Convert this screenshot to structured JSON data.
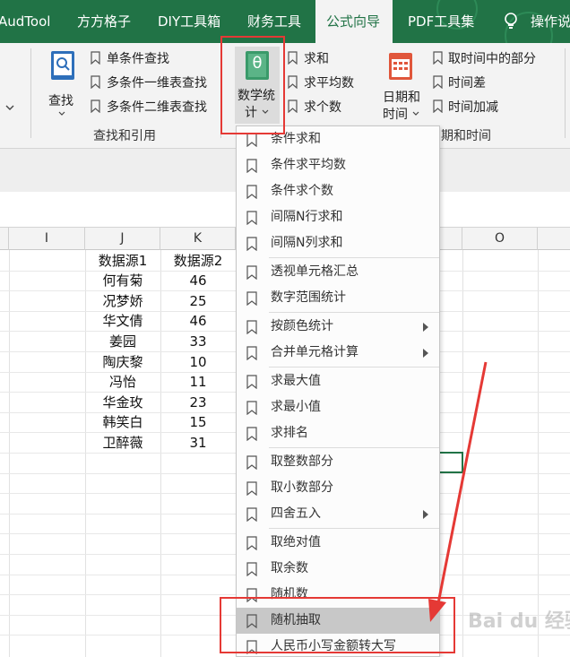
{
  "tabs": [
    {
      "label": "AudTool"
    },
    {
      "label": "方方格子"
    },
    {
      "label": "DIY工具箱"
    },
    {
      "label": "财务工具"
    },
    {
      "label": "公式向导"
    },
    {
      "label": "PDF工具集"
    },
    {
      "label": "操作说"
    }
  ],
  "ribbon": {
    "lookup": {
      "big_button_label": "查找",
      "items": [
        "单条件查找",
        "多条件一维表查找",
        "多条件二维表查找"
      ],
      "group_label": "查找和引用"
    },
    "math": {
      "big_button_line1": "数学统",
      "big_button_line2": "计",
      "big_button_glyph": "θ",
      "items": [
        "求和",
        "求平均数",
        "求个数"
      ]
    },
    "datetime": {
      "big_button_line1": "日期和",
      "big_button_line2": "时间",
      "items": [
        "取时间中的部分",
        "时间差",
        "时间加减"
      ],
      "group_label": "期和时间"
    }
  },
  "columns": [
    "I",
    "J",
    "K",
    "O"
  ],
  "table": {
    "headers": [
      "数据源1",
      "数据源2"
    ],
    "rows": [
      [
        "何有菊",
        "46"
      ],
      [
        "况梦娇",
        "25"
      ],
      [
        "华文倩",
        "46"
      ],
      [
        "姜园",
        "33"
      ],
      [
        "陶庆黎",
        "10"
      ],
      [
        "冯怡",
        "11"
      ],
      [
        "华金玫",
        "23"
      ],
      [
        "韩笑白",
        "15"
      ],
      [
        "卫醉薇",
        "31"
      ]
    ]
  },
  "menu": {
    "items": [
      {
        "label": "条件求和",
        "submenu": false
      },
      {
        "label": "条件求平均数",
        "submenu": false
      },
      {
        "label": "条件求个数",
        "submenu": false
      },
      {
        "label": "间隔N行求和",
        "submenu": false
      },
      {
        "label": "间隔N列求和",
        "submenu": false
      },
      {
        "label": "透视单元格汇总",
        "submenu": false
      },
      {
        "label": "数字范围统计",
        "submenu": false
      },
      {
        "label": "按颜色统计",
        "submenu": true
      },
      {
        "label": "合并单元格计算",
        "submenu": true
      },
      {
        "label": "求最大值",
        "submenu": false
      },
      {
        "label": "求最小值",
        "submenu": false
      },
      {
        "label": "求排名",
        "submenu": false
      },
      {
        "label": "取整数部分",
        "submenu": false
      },
      {
        "label": "取小数部分",
        "submenu": false
      },
      {
        "label": "四舍五入",
        "submenu": true
      },
      {
        "label": "取绝对值",
        "submenu": false
      },
      {
        "label": "取余数",
        "submenu": false
      },
      {
        "label": "随机数",
        "submenu": false
      },
      {
        "label": "随机抽取",
        "submenu": false,
        "highlighted": true
      },
      {
        "label": "人民币小写金额转大写",
        "submenu": false
      }
    ]
  },
  "watermark": "Bai du 经验",
  "colors": {
    "ribbon_green": "#217346",
    "annotation_red": "#e53935",
    "highlight_gray": "#c8c8c8"
  }
}
